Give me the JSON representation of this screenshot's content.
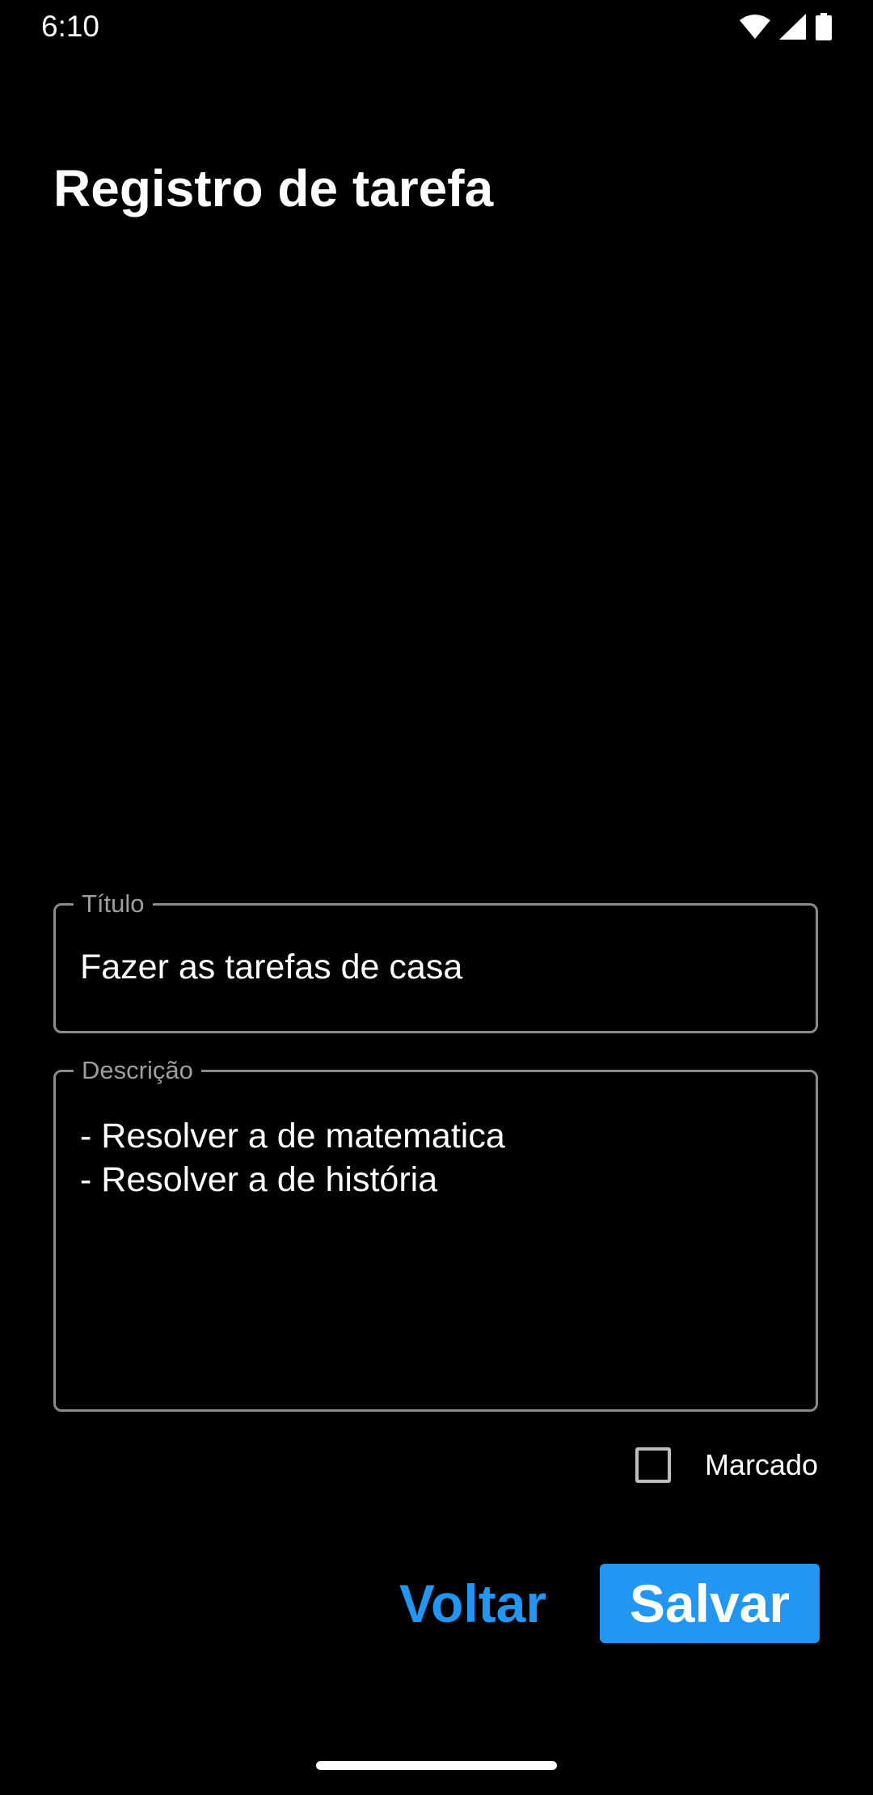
{
  "status_bar": {
    "time": "6:10",
    "icons": [
      "wifi-icon",
      "signal-icon",
      "battery-icon"
    ]
  },
  "page": {
    "title": "Registro de tarefa"
  },
  "form": {
    "title_field": {
      "label": "Título",
      "value": "Fazer as tarefas de casa"
    },
    "description_field": {
      "label": "Descrição",
      "lines": [
        "- Resolver a de matematica",
        "- Resolver a de história"
      ]
    },
    "checkbox": {
      "label": "Marcado",
      "checked": false
    }
  },
  "actions": {
    "back_label": "Voltar",
    "save_label": "Salvar"
  },
  "colors": {
    "background": "#000000",
    "accent": "#2196f3",
    "outline": "#8a8a8a"
  }
}
